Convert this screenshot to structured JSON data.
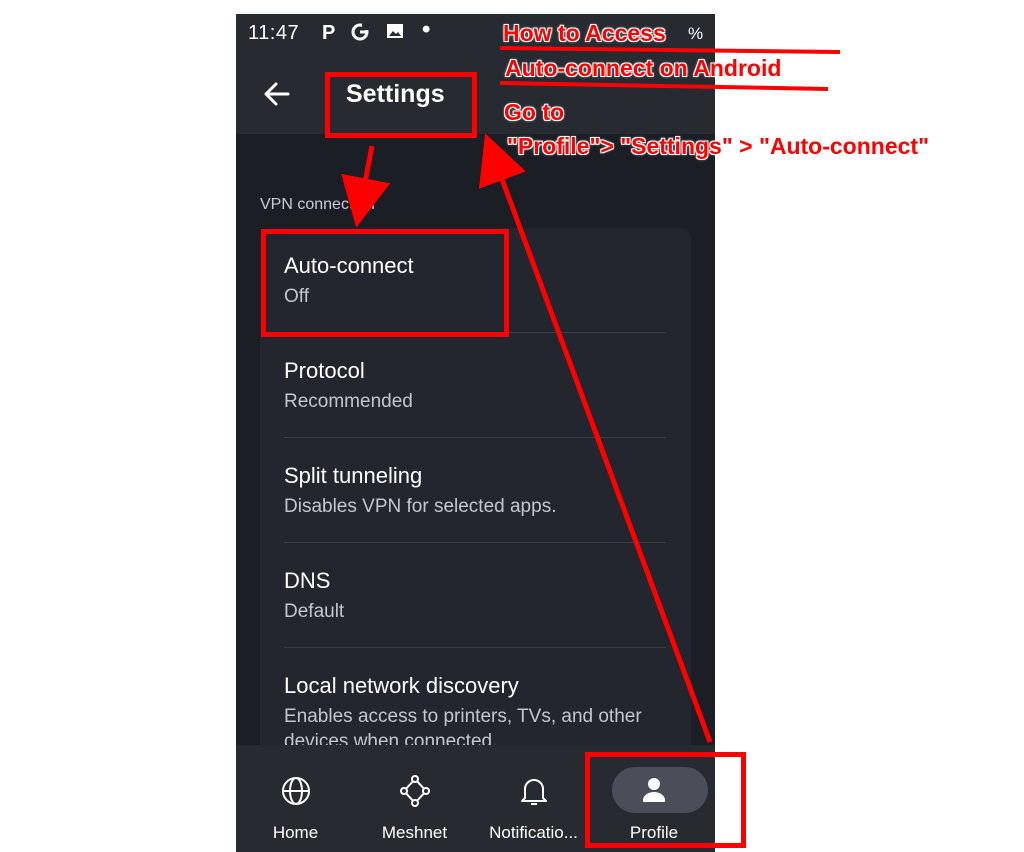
{
  "status_bar": {
    "time": "11:47",
    "icons": [
      "p-icon",
      "g-icon",
      "image-icon",
      "dot-icon"
    ],
    "battery_suffix": "%"
  },
  "app_bar": {
    "back_icon": "arrow-left-icon",
    "title": "Settings"
  },
  "section": {
    "label": "VPN connection"
  },
  "settings_items": [
    {
      "title": "Auto-connect",
      "subtitle": "Off"
    },
    {
      "title": "Protocol",
      "subtitle": "Recommended"
    },
    {
      "title": "Split tunneling",
      "subtitle": "Disables VPN for selected apps."
    },
    {
      "title": "DNS",
      "subtitle": "Default"
    },
    {
      "title": "Local network discovery",
      "subtitle": "Enables access to printers, TVs, and other devices when connected."
    }
  ],
  "bottom_nav": [
    {
      "label": "Home",
      "icon": "globe-icon",
      "active": false
    },
    {
      "label": "Meshnet",
      "icon": "meshnet-icon",
      "active": false
    },
    {
      "label": "Notificatio...",
      "icon": "bell-icon",
      "active": false
    },
    {
      "label": "Profile",
      "icon": "profile-icon",
      "active": true
    }
  ],
  "annotation": {
    "heading_line1": "How to Access",
    "heading_line2": "Auto-connect on Android",
    "instruction_line1": "Go to",
    "instruction_line2": "\"Profile\"> \"Settings\" > \"Auto-connect\"",
    "color": "#ff0000"
  },
  "colors": {
    "background": "#1c1e25",
    "bar": "#272a31",
    "card": "#23262e",
    "annotation": "#ff0000"
  }
}
